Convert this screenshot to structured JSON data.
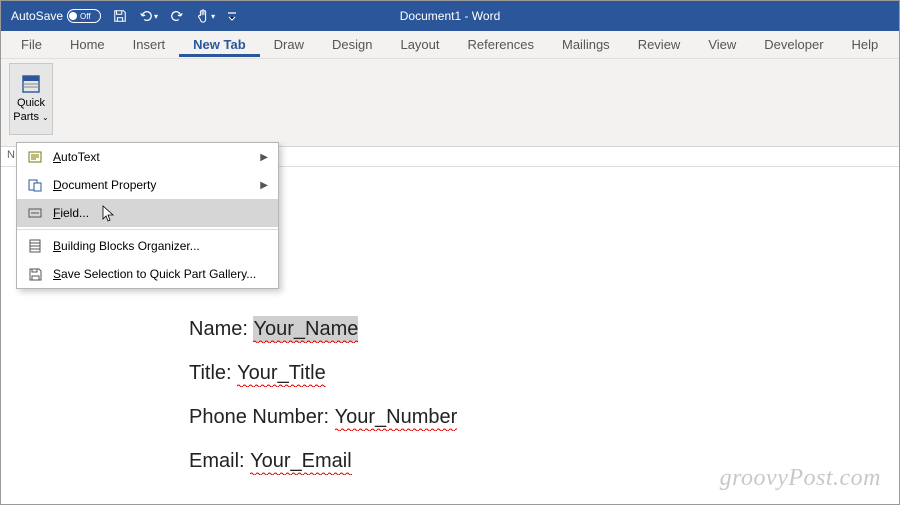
{
  "titlebar": {
    "autosave_label": "AutoSave",
    "toggle_state": "Off",
    "document_title": "Document1  -  Word"
  },
  "menu": {
    "items": [
      "File",
      "Home",
      "Insert",
      "New Tab",
      "Draw",
      "Design",
      "Layout",
      "References",
      "Mailings",
      "Review",
      "View",
      "Developer",
      "Help"
    ],
    "active_index": 3
  },
  "ribbon": {
    "quick_parts_label_1": "Quick",
    "quick_parts_label_2": "Parts"
  },
  "ruler": {
    "left_marker": "N"
  },
  "dropdown": {
    "items": [
      {
        "icon": "autotext-icon",
        "label": "AutoText",
        "u": "A",
        "rest": "utoText",
        "arrow": true
      },
      {
        "icon": "docprop-icon",
        "label": "Document Property",
        "u": "D",
        "rest": "ocument Property",
        "arrow": true
      },
      {
        "icon": "field-icon",
        "label": "Field...",
        "u": "F",
        "rest": "ield...",
        "hover": true
      },
      {
        "sep": true
      },
      {
        "icon": "bborg-icon",
        "label": "Building Blocks Organizer...",
        "u": "B",
        "rest": "uilding Blocks Organizer..."
      },
      {
        "icon": "savesel-icon",
        "label": "Save Selection to Quick Part Gallery...",
        "u": "S",
        "rest": "ave Selection to Quick Part Gallery..."
      }
    ]
  },
  "document": {
    "lines": [
      {
        "label": "Name: ",
        "value": "Your_Name",
        "selected": true
      },
      {
        "label": "Title: ",
        "value": "Your_Title"
      },
      {
        "label": "Phone Number: ",
        "value": "Your_Number"
      },
      {
        "label": "Email: ",
        "value": "Your_Email"
      }
    ]
  },
  "watermark": "groovyPost.com"
}
